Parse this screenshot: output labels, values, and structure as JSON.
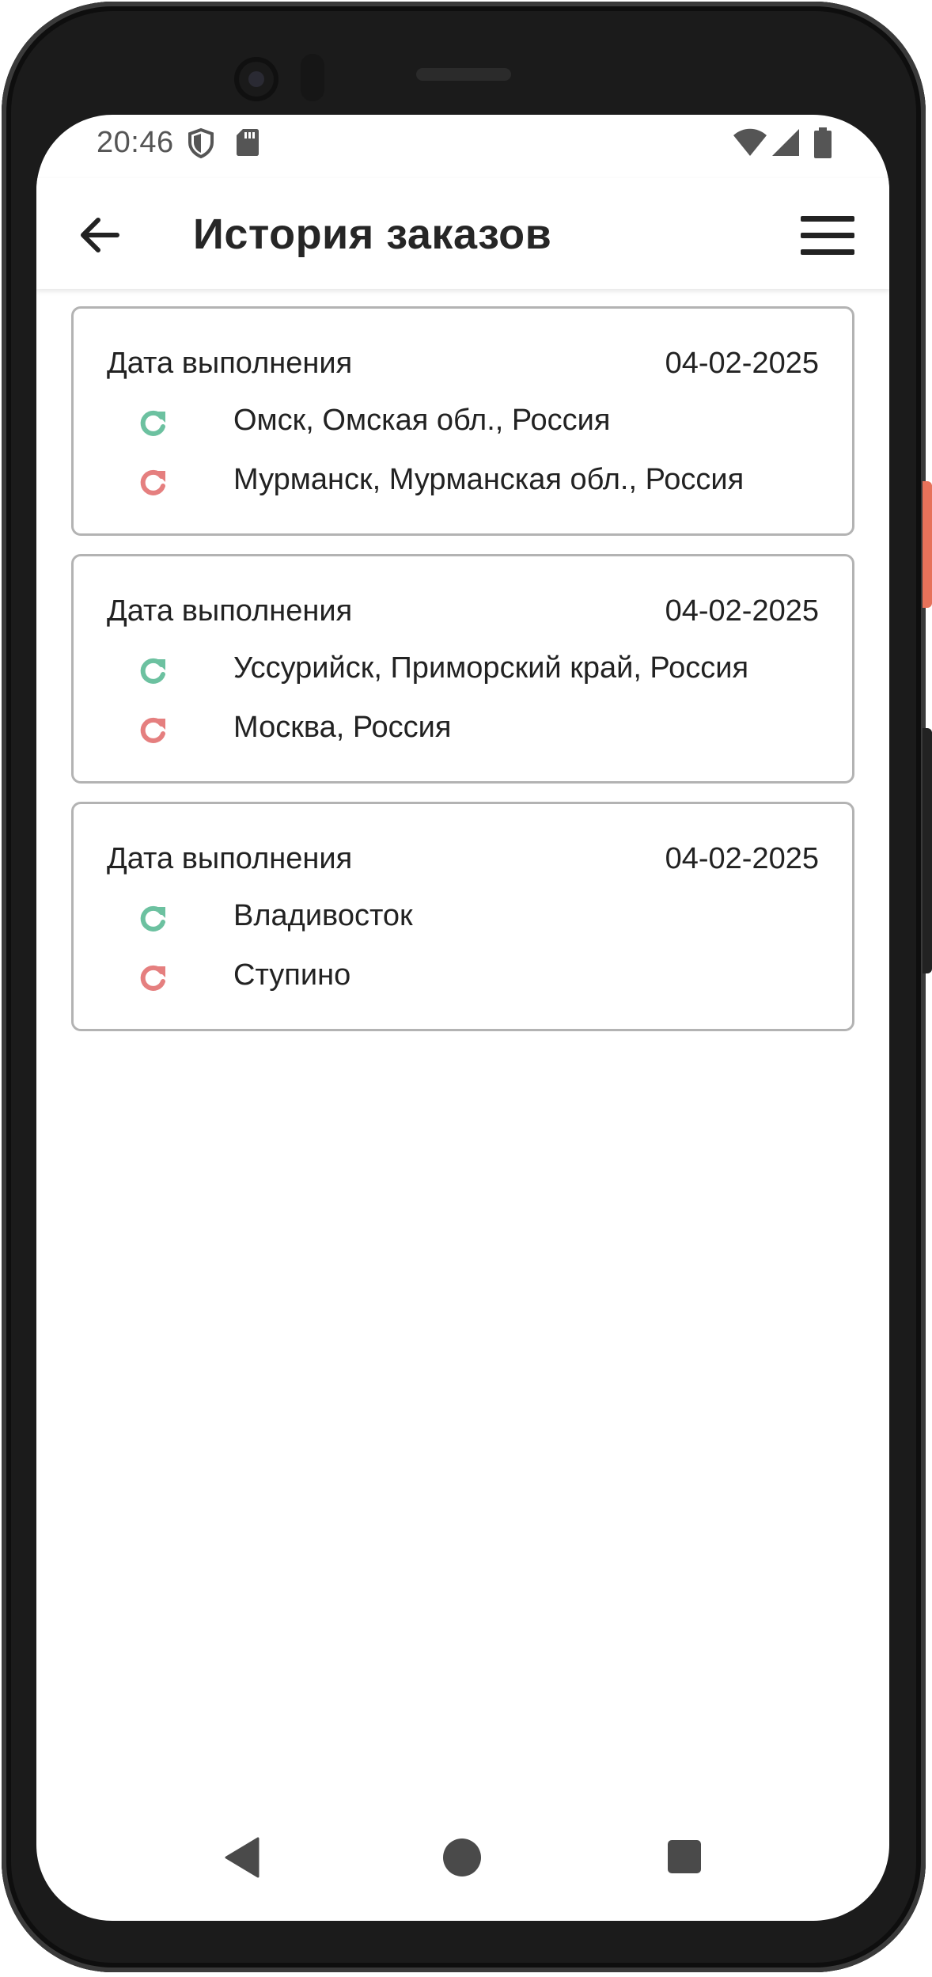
{
  "status_bar": {
    "time": "20:46",
    "icons": [
      "shield-icon",
      "sd-card-icon",
      "wifi-icon",
      "signal-icon",
      "battery-icon"
    ]
  },
  "app_bar": {
    "title": "История заказов",
    "back_icon": "arrow-left-icon",
    "menu_icon": "hamburger-menu-icon"
  },
  "colors": {
    "from_icon": "#6cc1a0",
    "to_icon": "#e57f7f",
    "card_border": "#b3b3b3"
  },
  "orders": [
    {
      "date_label": "Дата выполнения",
      "date": "04-02-2025",
      "from": "Омск, Омская обл., Россия",
      "to": "Мурманск, Мурманская обл., Россия"
    },
    {
      "date_label": "Дата выполнения",
      "date": "04-02-2025",
      "from": "Уссурийск, Приморский край, Россия",
      "to": "Москва, Россия"
    },
    {
      "date_label": "Дата выполнения",
      "date": "04-02-2025",
      "from": "Владивосток",
      "to": "Ступино"
    }
  ],
  "nav_bar": {
    "buttons": [
      "back-triangle-icon",
      "home-circle-icon",
      "recents-square-icon"
    ]
  }
}
